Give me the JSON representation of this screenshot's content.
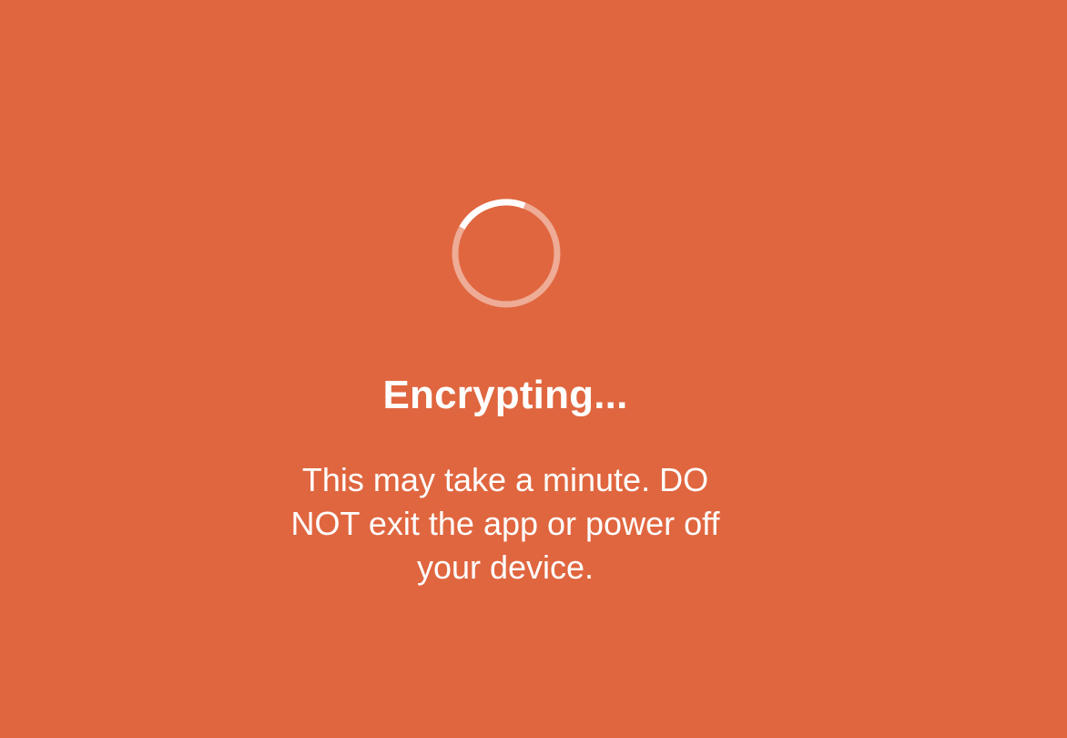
{
  "screen": {
    "background_color": "#E0663F",
    "title": "Encrypting...",
    "message": "This may take a minute. DO NOT exit the app or power off your device."
  },
  "spinner": {
    "icon": "loading-spinner-icon",
    "track_color": "rgba(255,255,255,0.45)",
    "arc_color": "#ffffff"
  }
}
